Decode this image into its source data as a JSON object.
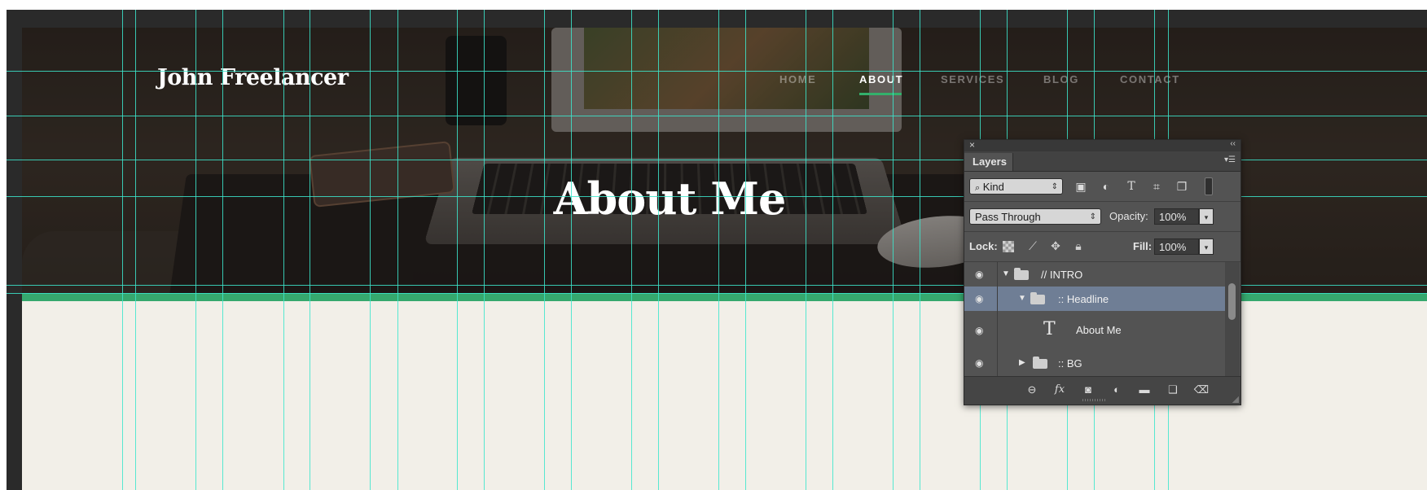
{
  "site": {
    "name": "John Freelancer",
    "heading": "About Me",
    "nav": [
      {
        "label": "HOME",
        "active": false
      },
      {
        "label": "ABOUT",
        "active": true
      },
      {
        "label": "SERVICES",
        "active": false
      },
      {
        "label": "BLOG",
        "active": false
      },
      {
        "label": "CONTACT",
        "active": false
      }
    ],
    "colors": {
      "accent": "#36a86e",
      "content_bg": "#f2efe8",
      "guide": "#3ce6cc"
    }
  },
  "layers_panel": {
    "tab_label": "Layers",
    "filter": {
      "kind_label": "Kind"
    },
    "blend": {
      "mode": "Pass Through",
      "opacity_label": "Opacity:",
      "opacity_value": "100%"
    },
    "lock": {
      "label": "Lock:",
      "fill_label": "Fill:",
      "fill_value": "100%"
    },
    "layers": [
      {
        "name": "// INTRO",
        "type": "group",
        "expanded": true,
        "visible": true,
        "selected": false
      },
      {
        "name": ":: Headline",
        "type": "group",
        "expanded": true,
        "visible": true,
        "selected": true
      },
      {
        "name": "About Me",
        "type": "text",
        "visible": true,
        "selected": false
      },
      {
        "name": ":: BG",
        "type": "group",
        "expanded": false,
        "visible": true,
        "selected": false
      }
    ],
    "icons": {
      "text_layer": "T",
      "filter_icons": [
        "image-filter-icon",
        "adjustment-filter-icon",
        "type-filter-icon",
        "shape-filter-icon",
        "smart-object-filter-icon"
      ],
      "footer_icons": [
        "link-layers-icon",
        "fx-icon",
        "mask-icon",
        "adjustment-layer-icon",
        "new-group-icon",
        "new-layer-icon",
        "trash-icon"
      ]
    }
  }
}
